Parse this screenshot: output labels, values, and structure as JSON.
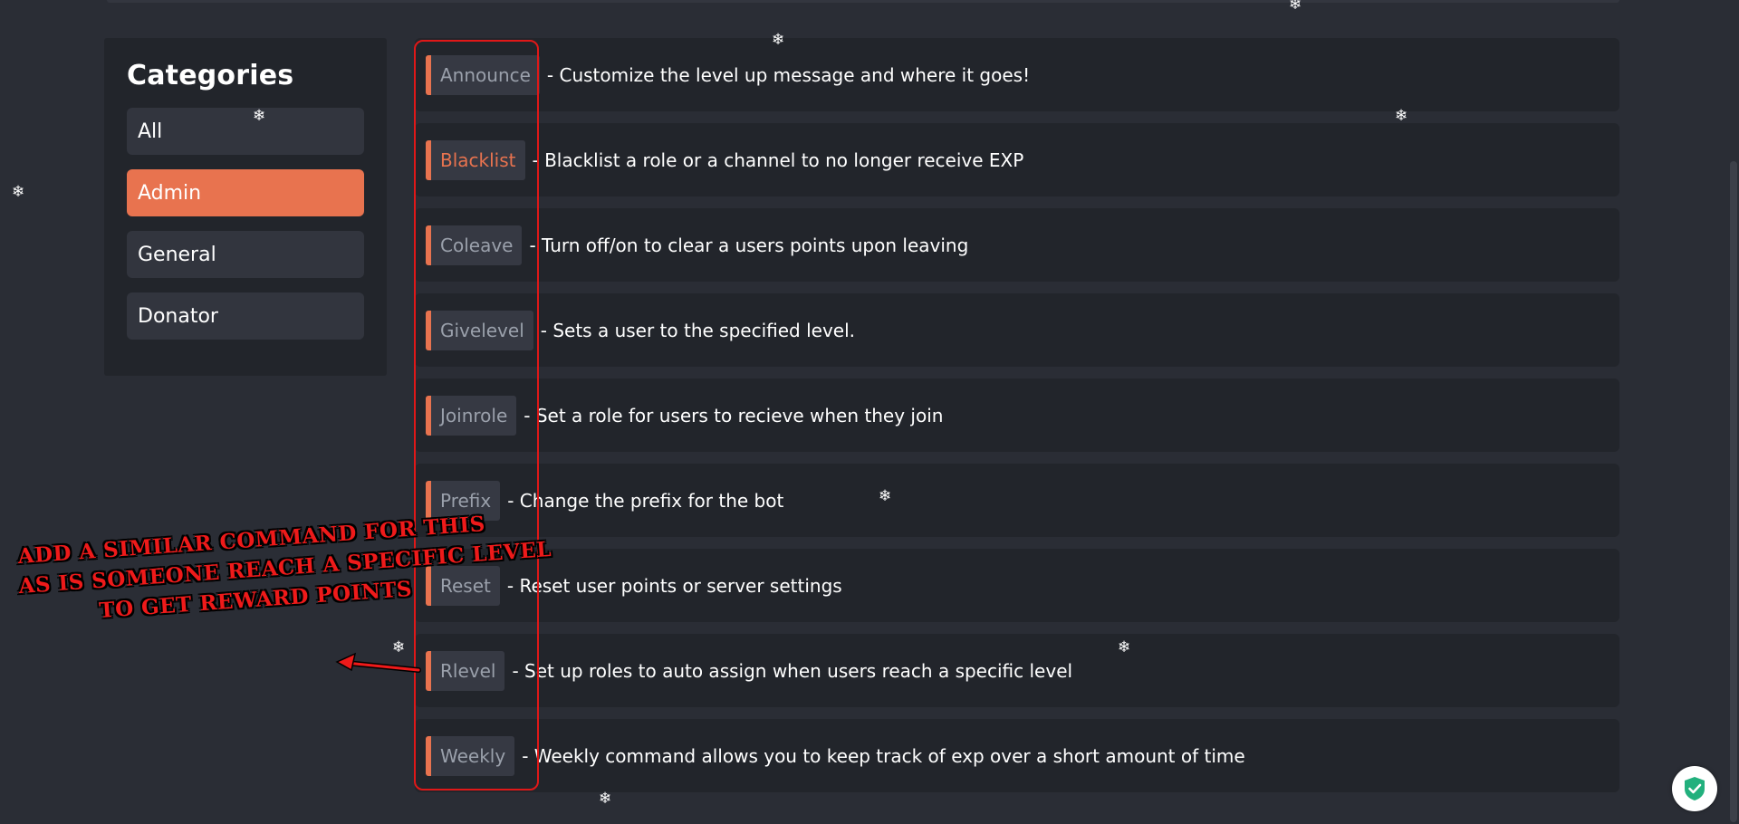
{
  "sidebar": {
    "title": "Categories",
    "categories": [
      {
        "label": "All",
        "active": false
      },
      {
        "label": "Admin",
        "active": true
      },
      {
        "label": "General",
        "active": false
      },
      {
        "label": "Donator",
        "active": false
      }
    ]
  },
  "commands": [
    {
      "name": "Announce",
      "description": "- Customize the level up message and where it goes!"
    },
    {
      "name": "Blacklist",
      "description": "- Blacklist a role or a channel to no longer receive EXP"
    },
    {
      "name": "Coleave",
      "description": "- Turn off/on to clear a users points upon leaving"
    },
    {
      "name": "Givelevel",
      "description": "- Sets a user to the specified level."
    },
    {
      "name": "Joinrole",
      "description": "- Set a role for users to recieve when they join"
    },
    {
      "name": "Prefix",
      "description": "- Change the prefix for the bot"
    },
    {
      "name": "Reset",
      "description": "- Reset user points or server settings"
    },
    {
      "name": "Rlevel",
      "description": "- Set up roles to auto assign when users reach a specific level"
    },
    {
      "name": "Weekly",
      "description": "- Weekly command allows you to keep track of exp over a short amount of time"
    }
  ],
  "annotation": {
    "lines": [
      "ADD A SIMILAR COMMAND FOR THIS",
      "AS IS SOMEONE REACH A SPECIFIC LEVEL",
      "TO GET REWARD POINTS"
    ]
  },
  "snowflake_glyph": "❄",
  "colors": {
    "accent": "#e8734f",
    "background": "#2a2d35",
    "panel": "#22252b",
    "annotation_red": "#ee1a1a"
  }
}
